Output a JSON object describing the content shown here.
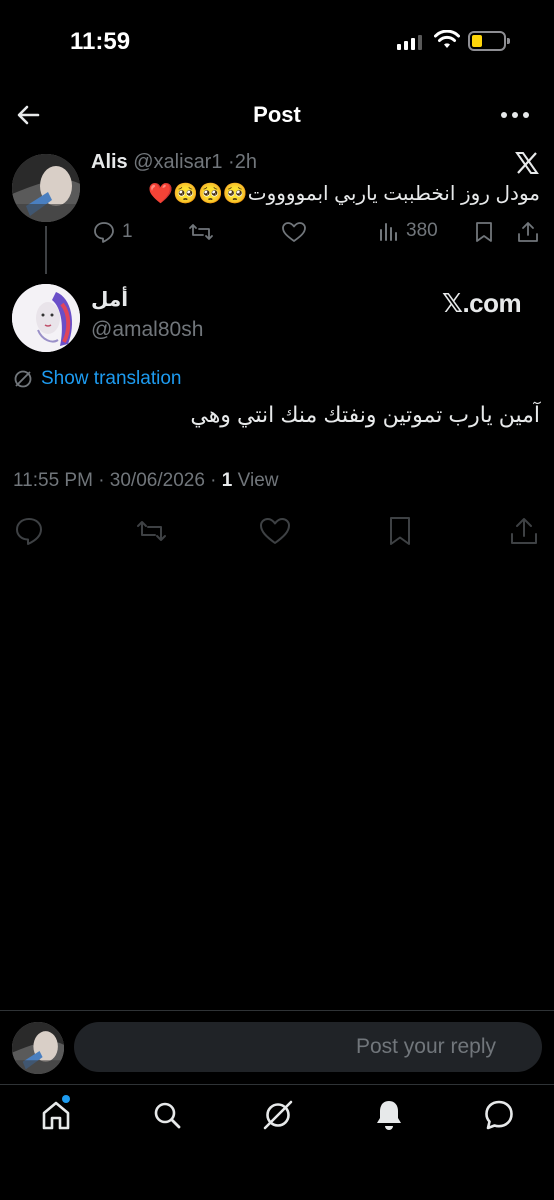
{
  "status_bar": {
    "time": "11:59",
    "battery_color": "#ffd60a"
  },
  "header": {
    "title": "Post",
    "back_icon": "arrow-left-icon",
    "more_icon": "more-horizontal-icon"
  },
  "parent_tweet": {
    "name": "Alis",
    "handle": "@xalisar1",
    "separator": "·",
    "time_ago": "2h",
    "text": "مودل روز انخطببت ياربي ابمووووت🥺🥺🥺❤️",
    "replies": "1",
    "views": "380"
  },
  "reply_tweet": {
    "name": "أمل",
    "handle": "@amal80sh",
    "brand_watermark": "𝕏.com",
    "show_translation": "Show translation",
    "text": "آمين يارب تموتين ونفتك منك انتي وهي",
    "timestamp": "11:55 PM · 30/06/2026 · ",
    "views_count": "1",
    "views_label": " View"
  },
  "reply_bar": {
    "placeholder": "Post your reply"
  },
  "colors": {
    "accent": "#1d9bf0",
    "muted": "#71767b",
    "text": "#e7e9ea",
    "background": "#000000"
  },
  "nav": {
    "items": [
      "home-icon",
      "search-icon",
      "grok-icon",
      "notifications-bell-icon",
      "messages-icon"
    ]
  }
}
